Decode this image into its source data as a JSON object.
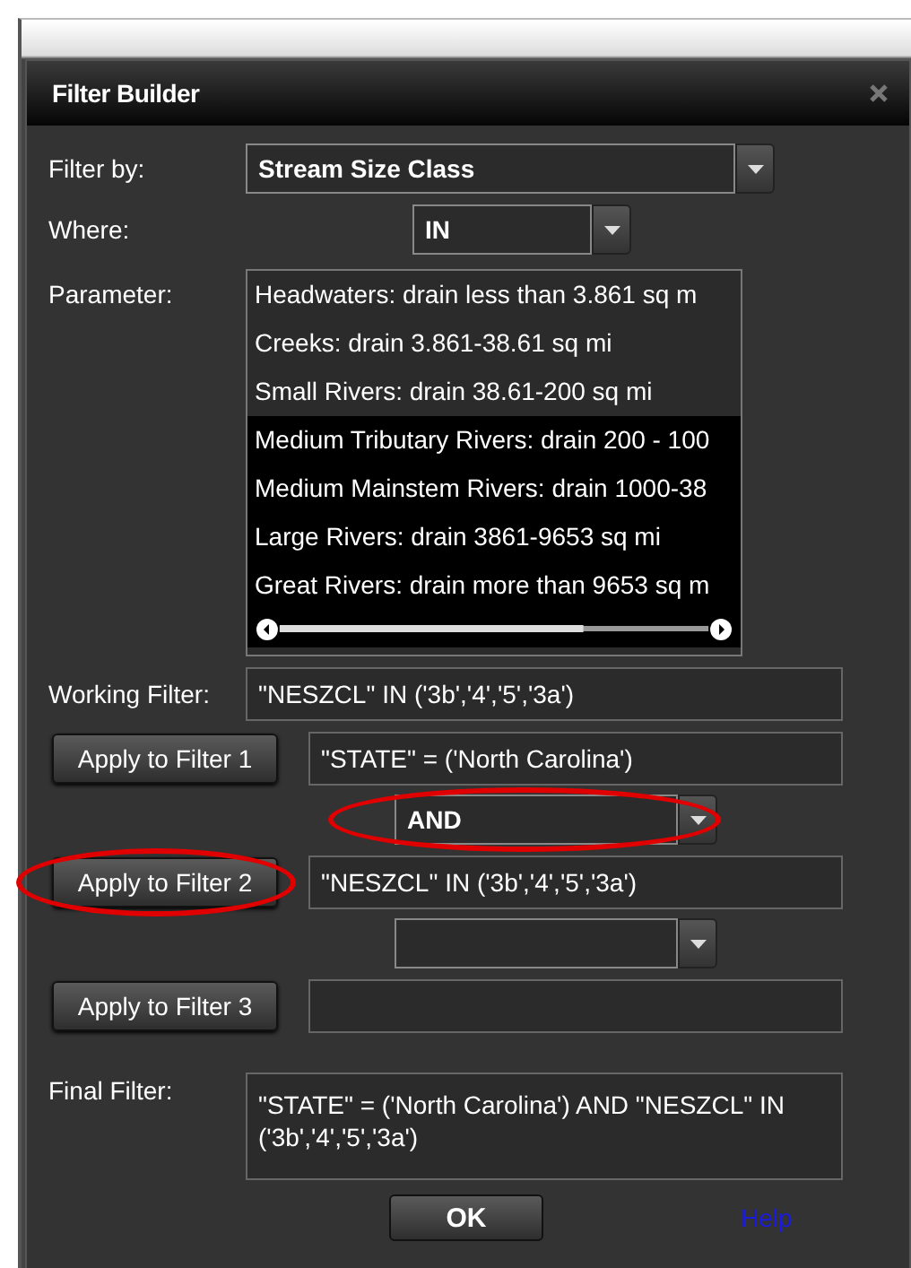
{
  "dialog": {
    "title": "Filter Builder",
    "filter_by": {
      "label": "Filter by:",
      "value": "Stream Size Class"
    },
    "where": {
      "label": "Where:",
      "value": "IN"
    },
    "parameter": {
      "label": "Parameter:",
      "items": [
        {
          "text": "Headwaters: drain less than 3.861 sq m",
          "selected": false
        },
        {
          "text": "Creeks: drain 3.861-38.61 sq mi",
          "selected": false
        },
        {
          "text": "Small Rivers: drain 38.61-200 sq mi",
          "selected": false
        },
        {
          "text": "Medium Tributary Rivers: drain 200 - 100",
          "selected": true
        },
        {
          "text": "Medium Mainstem Rivers: drain 1000-38",
          "selected": true
        },
        {
          "text": "Large Rivers: drain 3861-9653 sq mi",
          "selected": true
        },
        {
          "text": "Great Rivers: drain more than 9653 sq m",
          "selected": true
        }
      ]
    },
    "working_filter": {
      "label": "Working Filter:",
      "value": "\"NESZCL\" IN ('3b','4','5','3a')"
    },
    "filters": [
      {
        "button": "Apply to Filter 1",
        "value": "\"STATE\" = ('North Carolina')",
        "highlighted": false
      },
      {
        "button": "Apply to Filter 2",
        "value": "\"NESZCL\" IN ('3b','4','5','3a')",
        "highlighted": true
      },
      {
        "button": "Apply to Filter 3",
        "highlighted": false
      }
    ],
    "combiners": [
      {
        "value": "AND",
        "highlighted": true
      },
      {
        "highlighted": false
      }
    ],
    "final_filter": {
      "label": "Final Filter:",
      "value": "\"STATE\" = ('North Carolina') AND \"NESZCL\" IN ('3b','4','5','3a')"
    },
    "ok_button": "OK",
    "help_link": "Help"
  }
}
